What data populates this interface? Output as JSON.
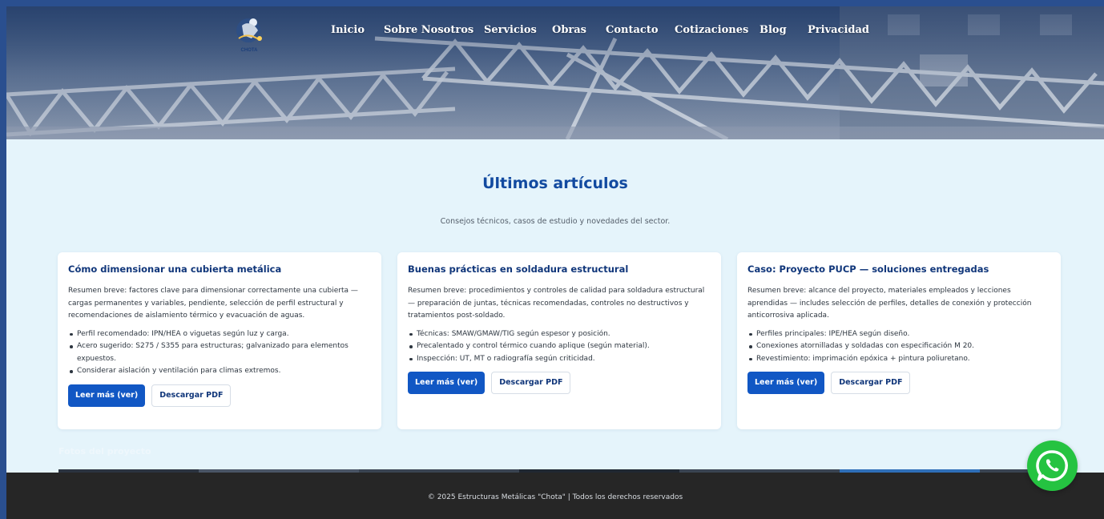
{
  "header": {
    "logo_text": "CHOTA",
    "nav": [
      {
        "label": "Inicio"
      },
      {
        "label": "Sobre Nosotros"
      },
      {
        "label": "Servicios"
      },
      {
        "label": "Obras"
      },
      {
        "label": "Contacto"
      },
      {
        "label": "Cotizaciones"
      },
      {
        "label": "Blog"
      },
      {
        "label": "Privacidad"
      }
    ]
  },
  "articles": {
    "title": "Últimos artículos",
    "subtitle": "Consejos técnicos, casos de estudio y novedades del sector.",
    "cards": [
      {
        "title": "Cómo dimensionar una cubierta metálica",
        "summary": "Resumen breve: factores clave para dimensionar correctamente una cubierta — cargas permanentes y variables, pendiente, selección de perfil estructural y recomendaciones de aislamiento térmico y evacuación de aguas.",
        "bullets": [
          "Perfil recomendado: IPN/HEA o viguetas según luz y carga.",
          "Acero sugerido: S275 / S355 para estructuras; galvanizado para elementos expuestos.",
          "Considerar aislación y ventilación para climas extremos."
        ],
        "read_more": "Leer más (ver)",
        "download": "Descargar PDF"
      },
      {
        "title": "Buenas prácticas en soldadura estructural",
        "summary": "Resumen breve: procedimientos y controles de calidad para soldadura estructural — preparación de juntas, técnicas recomendadas, controles no destructivos y tratamientos post-soldado.",
        "bullets": [
          "Técnicas: SMAW/GMAW/TIG según espesor y posición.",
          "Precalentado y control térmico cuando aplique (según material).",
          "Inspección: UT, MT o radiografía según criticidad."
        ],
        "read_more": "Leer más (ver)",
        "download": "Descargar PDF"
      },
      {
        "title": "Caso: Proyecto PUCP — soluciones entregadas",
        "summary": "Resumen breve: alcance del proyecto, materiales empleados y lecciones aprendidas — includes selección de perfiles, detalles de conexión y protección anticorrosiva aplicada.",
        "bullets": [
          "Perfiles principales: IPE/HEA según diseño.",
          "Conexiones atornilladas y soldadas con especificación M 20.",
          "Revestimiento: imprimación epóxica + pintura poliuretano."
        ],
        "read_more": "Leer más (ver)",
        "download": "Descargar PDF"
      }
    ]
  },
  "photos": {
    "title": "Fotos del proyecto"
  },
  "footer": {
    "text": "© 2025 Estructuras Metálicas \"Chota\" | Todos los derechos reservados"
  },
  "colors": {
    "accent": "#1157c4",
    "heading": "#124aa0",
    "section_bg": "#e5f4fb",
    "footer_bg": "#262626",
    "whatsapp": "#25c341"
  },
  "icons": {
    "floating_button": "whatsapp-icon",
    "logo": "welder-logo-icon"
  }
}
